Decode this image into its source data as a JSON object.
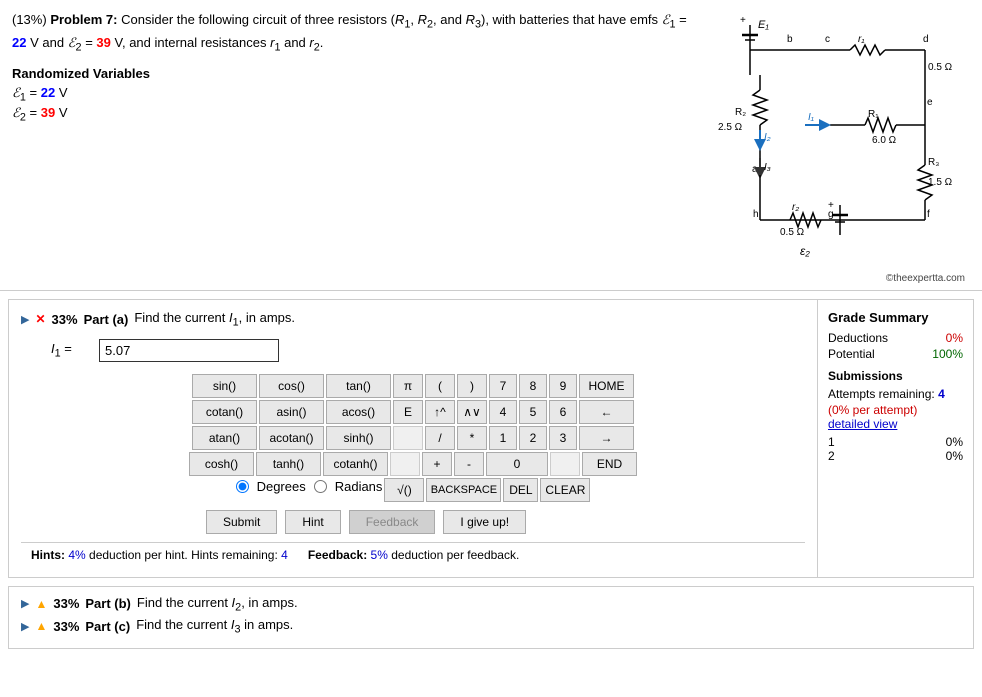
{
  "problem": {
    "percent": "(13%)",
    "number": "Problem 7:",
    "description": "Consider the following circuit of three resistors (R₁, R₂, and R₃), with batteries that have emfs",
    "emf1_label": "ℰ₁",
    "emf1_eq": "= 22 V",
    "emf1_val": "22",
    "and_text": "and",
    "emf2_label": "ℰ₂",
    "emf2_eq": "= 39 V",
    "emf2_val": "39",
    "suffix": ", and internal resistances r₁ and r₂.",
    "randomized_title": "Randomized Variables",
    "var1_label": "ℰ₁ =",
    "var1_val": "22",
    "var1_unit": "V",
    "var2_label": "ℰ₂ =",
    "var2_val": "39",
    "var2_unit": "V",
    "copyright": "©theexpertta.com"
  },
  "part_a": {
    "triangle": "▶",
    "x_icon": "✕",
    "pct": "33%",
    "part_label": "Part (a)",
    "description": "Find the current I₁, in amps.",
    "input_label": "I₁ =",
    "input_value": "5.07"
  },
  "calculator": {
    "row1": [
      "sin()",
      "cos()",
      "tan()",
      "π",
      "(",
      ")",
      "7",
      "8",
      "9",
      "HOME"
    ],
    "row2": [
      "cotan()",
      "asin()",
      "acos()",
      "E",
      "↑^",
      "∧∨",
      "4",
      "5",
      "6",
      "←"
    ],
    "row3": [
      "atan()",
      "acotan()",
      "sinh()",
      "",
      "/",
      "*",
      "1",
      "2",
      "3",
      "→"
    ],
    "row4": [
      "cosh()",
      "tanh()",
      "cotanh()",
      "",
      "+",
      "-",
      "0",
      "",
      "",
      "END"
    ],
    "row5": [
      "",
      "",
      "",
      "",
      "√()",
      "BACKSPACE",
      "DEL",
      "CLEAR"
    ],
    "degrees_label": "Degrees",
    "radians_label": "Radians"
  },
  "action_buttons": {
    "submit": "Submit",
    "hint": "Hint",
    "feedback": "Feedback",
    "give_up": "I give up!"
  },
  "hints_bar": {
    "text": "Hints:",
    "hint_pct": "4%",
    "hint_desc": "deduction per hint. Hints remaining:",
    "hints_remaining": "4"
  },
  "feedback_bar": {
    "label": "Feedback:",
    "pct": "5%",
    "desc": "deduction per feedback."
  },
  "grade_summary": {
    "title": "Grade Summary",
    "deductions_label": "Deductions",
    "deductions_val": "0%",
    "potential_label": "Potential",
    "potential_val": "100%",
    "submissions_title": "Submissions",
    "attempts_label": "Attempts remaining:",
    "attempts_val": "4",
    "deduction_line": "(0% per attempt)",
    "detailed_view": "detailed view",
    "attempt_rows": [
      {
        "num": "1",
        "val": "0%"
      },
      {
        "num": "2",
        "val": "0%"
      }
    ]
  },
  "bottom_parts": {
    "part_b": {
      "triangle": "▶",
      "warn": "▲",
      "pct": "33%",
      "label": "Part (b)",
      "desc": "Find the current I₂, in amps."
    },
    "part_c": {
      "triangle": "▶",
      "warn": "▲",
      "pct": "33%",
      "label": "Part (c)",
      "desc": "Find the current I₃ in amps."
    }
  },
  "colors": {
    "blue": "#0000ff",
    "red": "#ff0000",
    "green": "#006600",
    "orange": "#cc6600",
    "link": "#0000cc"
  }
}
